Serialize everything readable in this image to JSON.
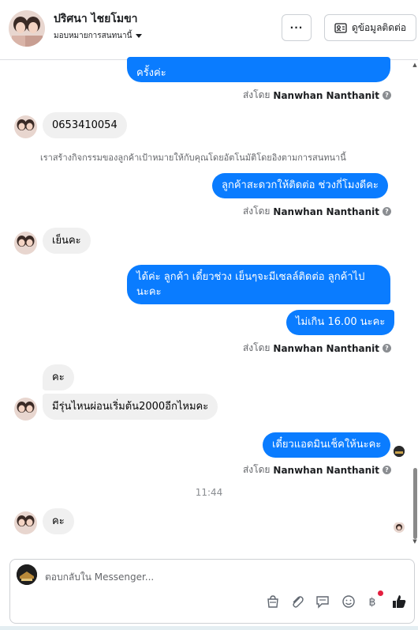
{
  "header": {
    "name": "ปริศนา ไชยโมขา",
    "assign_label": "มอบหมายการสนทนานี้",
    "more_label": "···",
    "contact_button": "ดูข้อมูลติดต่อ"
  },
  "messages": {
    "m1_text": "ครั้งค่ะ",
    "sent_prefix": "ส่งโดย",
    "sender_name": "Nanwhan Nanthanit",
    "help_glyph": "?",
    "m2_text": "0653410054",
    "notice": "เราสร้างกิจกรรมของลูกค้าเป้าหมายให้กับคุณโดยอัตโนมัติโดยอิงตามการสนทนานี้",
    "m3_text": "ลูกค้าสะดวกให้ติดต่อ ช่วงกี่โมงดีคะ",
    "m4_text": "เย็นคะ",
    "m5_line1": "ได้ค่ะ ลูกค้า เดี๋ยวช่วง เย็นๆจะมีเซลล์ติดต่อ ลูกค้าไป",
    "m5_line2": "นะคะ",
    "m6_text": "ไม่เกิน 16.00 นะคะ",
    "m7_text": "คะ",
    "m8_text": "มีรุ่นไหนผ่อนเริ่มต้น2000อีกไหมคะ",
    "m9_text": "เดี๋ยวแอดมินเช็คให้นะคะ",
    "timestamp": "11:44",
    "m10_text": "คะ"
  },
  "composer": {
    "placeholder": "ตอบกลับใน Messenger..."
  },
  "colors": {
    "outgoing_bubble": "#0a7cff",
    "incoming_bubble": "#f0f0f0",
    "like_icon": "#1c1e21",
    "notification_dot": "#e41e3f"
  }
}
